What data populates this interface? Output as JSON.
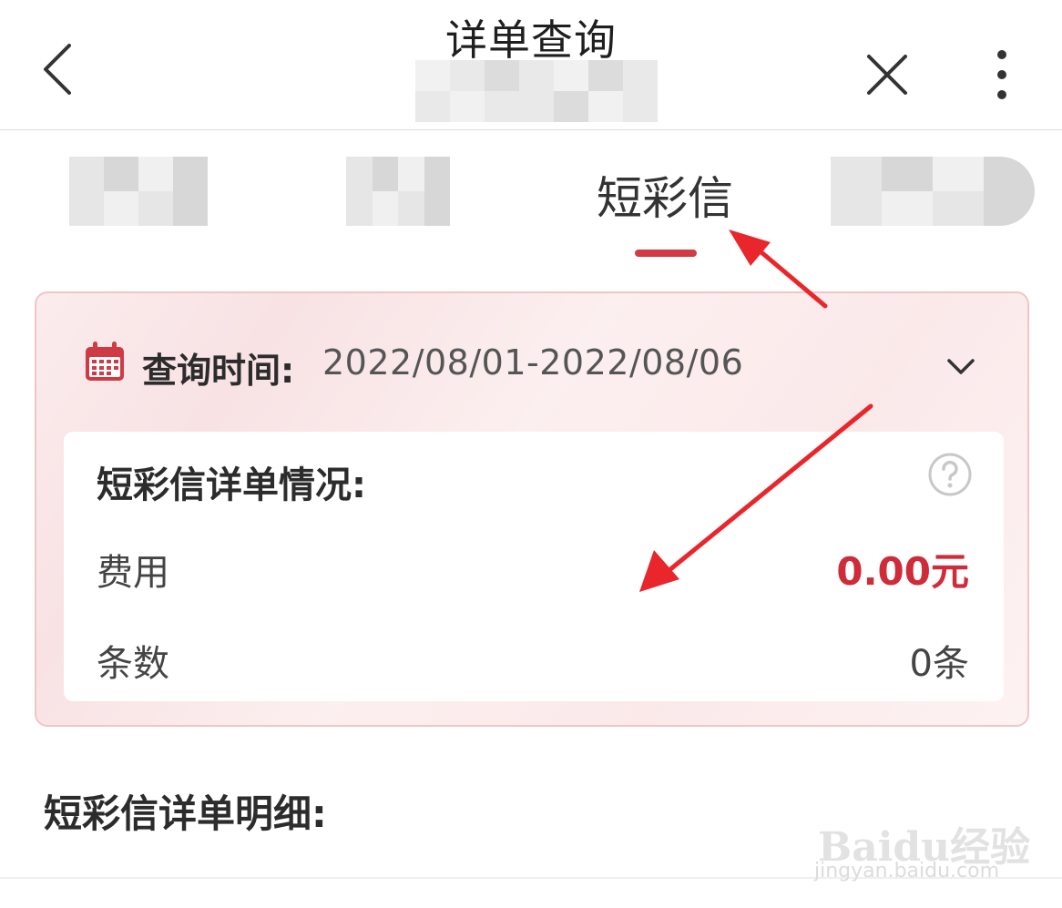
{
  "header": {
    "title": "详单查询",
    "back_icon": "chevron-left-icon",
    "close_icon": "close-icon",
    "more_icon": "more-vertical-icon"
  },
  "tabs": {
    "active_label": "短彩信",
    "indicator_color": "#d33a44"
  },
  "query": {
    "label": "查询时间:",
    "value": "2022/08/01-2022/08/06",
    "calendar_icon": "calendar-icon",
    "expand_icon": "chevron-down-icon"
  },
  "summary": {
    "title": "短彩信详单情况:",
    "help_icon": "question-circle-icon",
    "rows": [
      {
        "label": "费用",
        "value": "0.00元"
      },
      {
        "label": "条数",
        "value": "0条"
      }
    ],
    "fee_color": "#cf2c3a"
  },
  "details": {
    "title": "短彩信详单明细:"
  },
  "watermark": {
    "logo": "Baidu经验",
    "url": "jingyan.baidu.com"
  },
  "annotation_color": "#e8262b"
}
